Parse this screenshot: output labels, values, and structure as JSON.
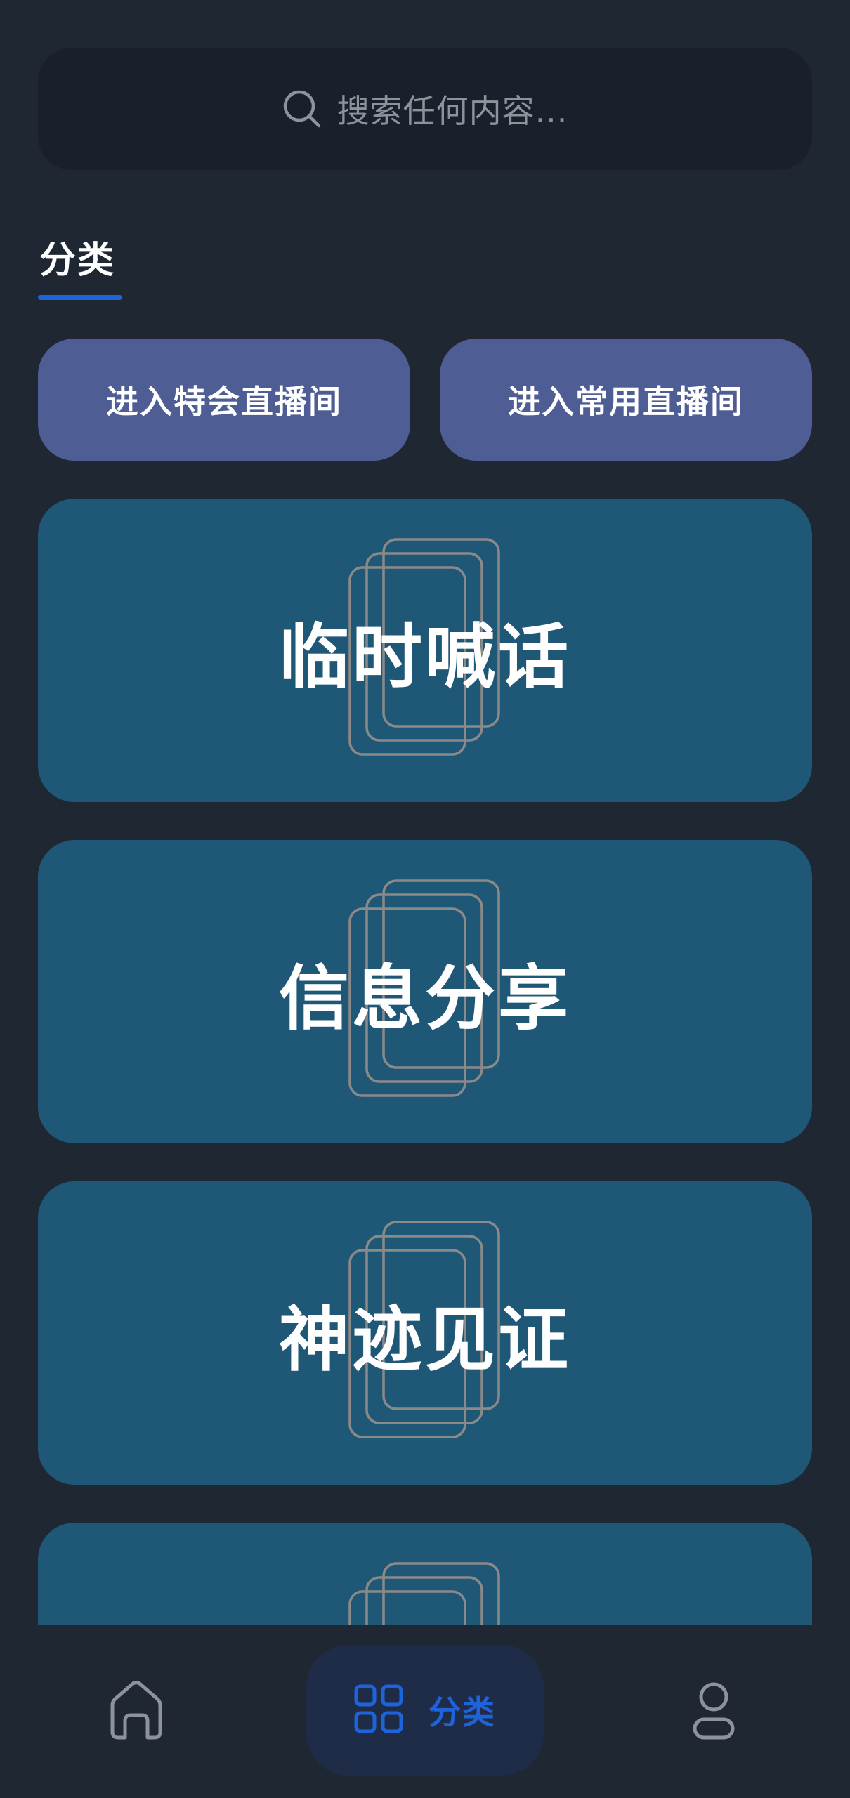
{
  "search": {
    "icon": "search-icon",
    "placeholder": "搜索任何内容..."
  },
  "section": {
    "title": "分类"
  },
  "live_buttons": {
    "special": "进入特会直播间",
    "common": "进入常用直播间"
  },
  "cards": [
    {
      "label": "临时喊话",
      "icon": "stacked-cards-icon"
    },
    {
      "label": "信息分享",
      "icon": "stacked-cards-icon"
    },
    {
      "label": "神迹见证",
      "icon": "stacked-cards-icon"
    },
    {
      "label": "",
      "icon": "stacked-cards-icon"
    }
  ],
  "bottom_nav": {
    "home_icon": "home-icon",
    "category_icon": "grid-icon",
    "category_label": "分类",
    "profile_icon": "user-icon",
    "active": "category"
  },
  "colors": {
    "background": "#1f2733",
    "search_bg": "#1a202b",
    "button_bg": "#4f5d95",
    "card_bg": "#1f5777",
    "accent": "#1e63d9",
    "nav_active_bg": "#1e2c47"
  }
}
